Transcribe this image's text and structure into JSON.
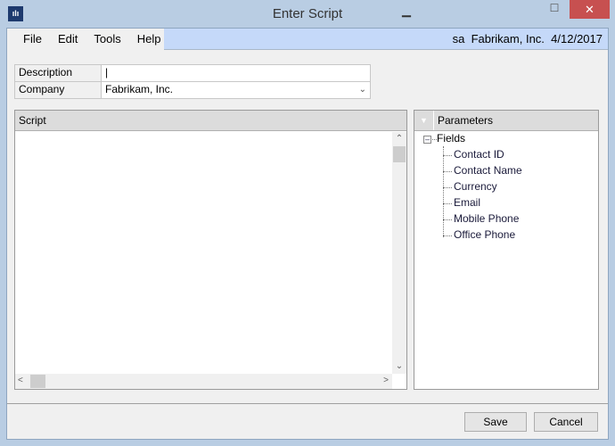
{
  "window": {
    "title": "Enter Script",
    "minimize": "▁",
    "maximize": "☐",
    "close": "✕",
    "icon": "app-logo-icon"
  },
  "menu": {
    "items": [
      "File",
      "Edit",
      "Tools",
      "Help"
    ],
    "user": "sa",
    "company": "Fabrikam, Inc.",
    "date": "4/12/2017"
  },
  "form": {
    "description_label": "Description",
    "description_value": "|",
    "company_label": "Company",
    "company_value": "Fabrikam, Inc."
  },
  "script": {
    "header": "Script",
    "value": ""
  },
  "parameters": {
    "header": "Parameters",
    "root": "Fields",
    "items": [
      "Contact ID",
      "Contact Name",
      "Currency",
      "Email",
      "Mobile Phone",
      "Office Phone"
    ]
  },
  "buttons": {
    "save": "Save",
    "cancel": "Cancel"
  },
  "colors": {
    "frame": "#b9cde3",
    "close": "#c75050",
    "menu_accent": "#c5d9f9"
  }
}
